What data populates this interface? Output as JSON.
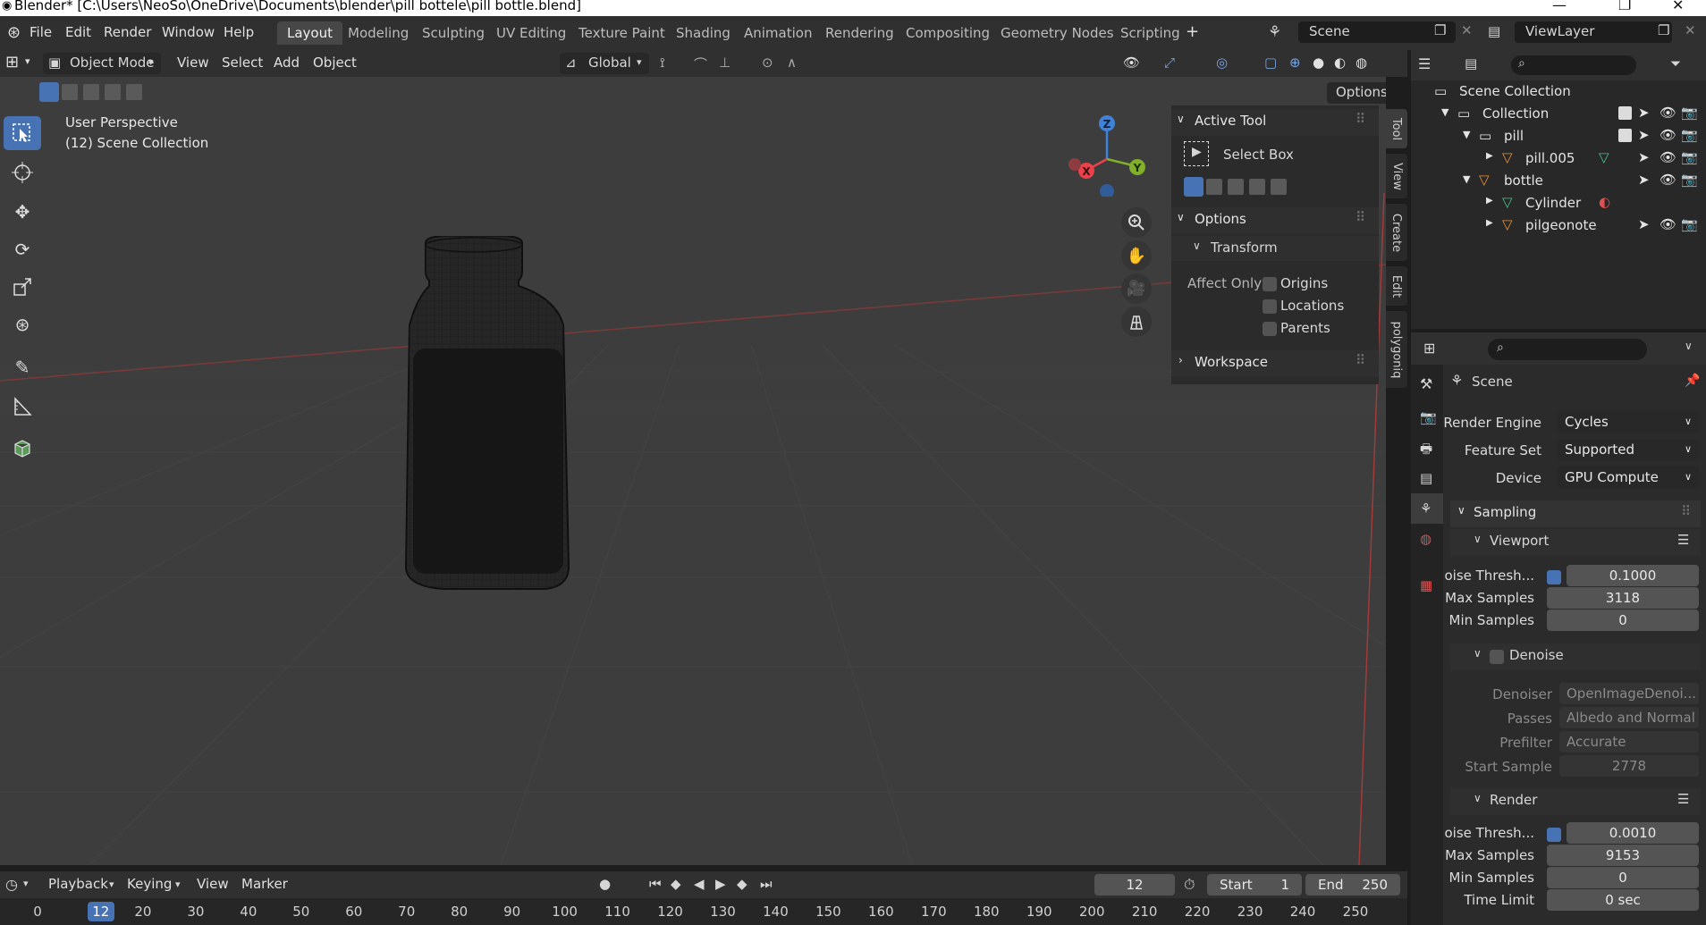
{
  "window": {
    "title": "Blender* [C:\\Users\\NeoSo\\OneDrive\\Documents\\blender\\pill bottele\\pill bottle.blend]"
  },
  "menu": {
    "file": "File",
    "edit": "Edit",
    "render": "Render",
    "window": "Window",
    "help": "Help"
  },
  "workspaces": [
    "Layout",
    "Modeling",
    "Sculpting",
    "UV Editing",
    "Texture Paint",
    "Shading",
    "Animation",
    "Rendering",
    "Compositing",
    "Geometry Nodes",
    "Scripting"
  ],
  "scene_name": "Scene",
  "view_layer": "ViewLayer",
  "viewport_header": {
    "mode": "Object Mode",
    "view": "View",
    "select": "Select",
    "add": "Add",
    "object": "Object",
    "orientation": "Global",
    "options": "Options"
  },
  "viewport": {
    "perspective": "User Perspective",
    "collection": "(12) Scene Collection",
    "gizmo": {
      "x": "X",
      "y": "Y",
      "z": "Z"
    },
    "colors": {
      "x": "#e8434a",
      "y": "#82b02a",
      "z": "#3f82d9",
      "bg": "#3d3d3d"
    }
  },
  "tool_panel": {
    "active_tool_title": "Active Tool",
    "tool_name": "Select Box",
    "options_title": "Options",
    "transform_title": "Transform",
    "affect_only_label": "Affect Only",
    "affect": [
      {
        "label": "Origins",
        "checked": false
      },
      {
        "label": "Locations",
        "checked": false
      },
      {
        "label": "Parents",
        "checked": false
      }
    ],
    "workspace_title": "Workspace"
  },
  "side_tabs": [
    "Tool",
    "View",
    "Create",
    "Edit",
    "polygoniq"
  ],
  "outliner": {
    "rows": [
      {
        "label": "Scene Collection"
      },
      {
        "label": "Collection"
      },
      {
        "label": "pill"
      },
      {
        "label": "pill.005"
      },
      {
        "label": "bottle"
      },
      {
        "label": "Cylinder"
      },
      {
        "label": "pilgeonote"
      }
    ]
  },
  "properties": {
    "context": "Scene",
    "render_engine_label": "Render Engine",
    "render_engine": "Cycles",
    "feature_set_label": "Feature Set",
    "feature_set": "Supported",
    "device_label": "Device",
    "device": "GPU Compute",
    "sampling_title": "Sampling",
    "viewport_title": "Viewport",
    "viewport_noise_label": "Noise Thresh...",
    "viewport_noise": "0.1000",
    "viewport_max_label": "Max Samples",
    "viewport_max": "3118",
    "viewport_min_label": "Min Samples",
    "viewport_min": "0",
    "denoise_title": "Denoise",
    "denoiser_label": "Denoiser",
    "denoiser": "OpenImageDenoi...",
    "passes_label": "Passes",
    "passes": "Albedo and Normal",
    "prefilter_label": "Prefilter",
    "prefilter": "Accurate",
    "start_sample_label": "Start Sample",
    "start_sample": "2778",
    "render_title": "Render",
    "render_noise_label": "Noise Thresh...",
    "render_noise": "0.0010",
    "render_max_label": "Max Samples",
    "render_max": "9153",
    "render_min_label": "Min Samples",
    "render_min": "0",
    "time_limit_label": "Time Limit",
    "time_limit": "0 sec"
  },
  "timeline": {
    "playback": "Playback",
    "keying": "Keying",
    "view": "View",
    "marker": "Marker",
    "current_frame": "12",
    "start_label": "Start",
    "start": "1",
    "end_label": "End",
    "end": "250",
    "ticks": [
      "0",
      "12",
      "20",
      "30",
      "40",
      "50",
      "60",
      "70",
      "80",
      "90",
      "100",
      "110",
      "120",
      "130",
      "140",
      "150",
      "160",
      "170",
      "180",
      "190",
      "200",
      "210",
      "220",
      "230",
      "240",
      "250"
    ]
  },
  "accent_color": "#4772b3"
}
